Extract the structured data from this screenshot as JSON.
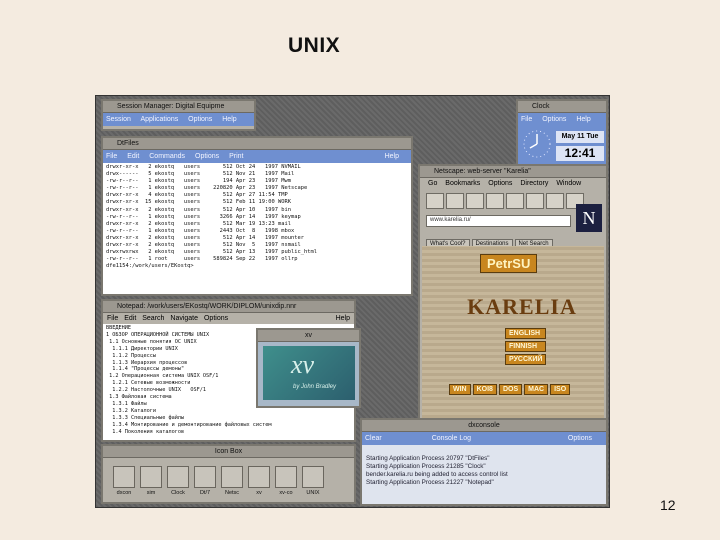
{
  "slide": {
    "title": "UNIX",
    "page_number": "12"
  },
  "session_manager": {
    "title": "Session Manager: Digital Equipme",
    "menu": [
      "Session",
      "Applications",
      "Options",
      "Help"
    ]
  },
  "dtfiles": {
    "title": "DtFiles",
    "menu": [
      "File",
      "Edit",
      "Commands",
      "Options",
      "Print"
    ],
    "help": "Help",
    "lines": [
      "drwxr-xr-x   2 ekostq   users       512 Oct 24   1997 NVMAIL",
      "drwx------   5 ekostq   users       512 Nov 21   1997 Mail",
      "-rw-r--r--   1 ekostq   users       194 Apr 23   1997 Mwm",
      "-rw-r--r--   1 ekostq   users    220820 Apr 23   1997 Netscape",
      "drwxr-xr-x   4 ekostq   users       512 Apr 27 11:54 TMP",
      "drwxr-xr-x  15 ekostq   users       512 Feb 11 19:00 WORK",
      "drwxr-xr-x   2 ekostq   users       512 Apr 10   1997 bin",
      "-rw-r--r--   1 ekostq   users      3266 Apr 14   1997 keymap",
      "drwxr-xr-x   2 ekostq   users       512 Mar 19 13:23 mail",
      "-rw-r--r--   1 ekostq   users      2443 Oct  8   1998 mbox",
      "drwxr-xr-x   2 ekostq   users       512 Apr 14   1997 mounter",
      "drwxr-xr-x   2 ekostq   users       512 Nov  5   1997 nsmail",
      "drwxrwxrwx   2 ekostq   users       512 Apr 13   1997 public_html",
      "-rw-r--r--   1 root     users    589824 Sep 22   1997 ollrp",
      "dfe1154:/work/users/EKostq>"
    ]
  },
  "clock": {
    "title": "Clock",
    "menu": [
      "File",
      "Options",
      "Help"
    ],
    "date": "May 11 Tue",
    "time": "12:41"
  },
  "netscape": {
    "title": "Netscape: web-server \"Karelia\"",
    "menu": [
      "Go",
      "Bookmarks",
      "Options",
      "Directory",
      "Window"
    ],
    "location": "www.karelia.ru/",
    "buttons": [
      "What's Cool?",
      "Destinations",
      "Net Search"
    ],
    "logo_letter": "N",
    "site_badge": "PetrSU",
    "site_name": "KARELIA",
    "languages": [
      "ENGLISH",
      "FINNISH",
      "РУССКИЙ"
    ],
    "encodings": [
      "WIN",
      "KOI8",
      "DOS",
      "MAC",
      "ISO"
    ]
  },
  "notepad": {
    "title": "Notepad: /work/users/EKostq/WORK/DIPLOM/unixdip.nnr",
    "menu": [
      "File",
      "Edit",
      "Search",
      "Navigate",
      "Options"
    ],
    "help": "Help",
    "lines": [
      "ВВЕДЕНИЕ",
      "1 ОБЗОР ОПЕРАЦИОННОЙ СИСТЕМЫ UNIX",
      " 1.1 Основные понятия ОС UNIX",
      "  1.1.1 Директории UNIX",
      "  1.1.2 Процессы",
      "  1.1.3 Иерархия процессов",
      "  1.1.4 \"Процессы демоны\"",
      " 1.2 Операционная система UNIX OSF/1",
      "  1.2.1 Сетевые возможности",
      "  1.2.2 Настолочные UNIX   OSF/1",
      " 1.3 Файловая система",
      "  1.3.1 Файлы",
      "  1.3.2 Каталоги",
      "  1.3.3 Специальные файлы",
      "  1.3.4 Монтирование и демонтирование файловых систем",
      "  1.4 Поколения каталогов"
    ]
  },
  "xv": {
    "title": "xv",
    "logo": "xv",
    "caption": "by John Bradley"
  },
  "dxconsole": {
    "title": "dxconsole",
    "menu": [
      "Clear",
      "Console Log",
      "Options"
    ],
    "lines": [
      "Starting Application Process 20797 \"DtFiles\"",
      "Starting Application Process 21285 \"Clock\"",
      "bender.karelia.ru being added to access control list",
      "Starting Application Process 21227 \"Notepad\""
    ]
  },
  "toolbox": {
    "title": "Icon Box",
    "items": [
      "dxcon",
      "sim",
      "Clock",
      "Dt/7",
      "Netsc",
      "xv",
      "xv-co",
      "UNIX"
    ]
  }
}
